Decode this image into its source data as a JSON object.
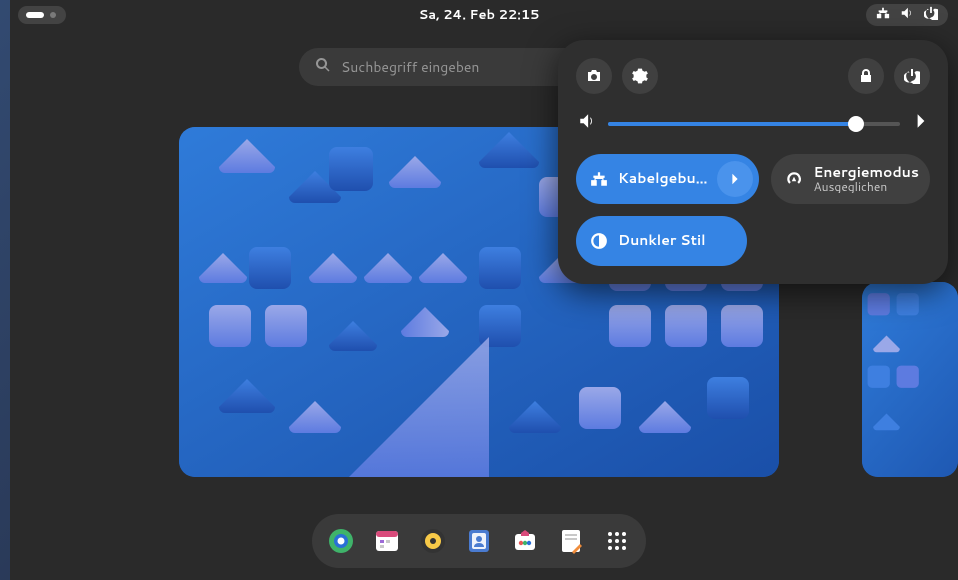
{
  "topbar": {
    "datetime": "Sa, 24. Feb  22:15"
  },
  "search": {
    "placeholder": "Suchbegriff eingeben"
  },
  "quick_settings": {
    "volume_percent": 85,
    "tiles": {
      "network": {
        "label": "Kabelgebu…",
        "active": true,
        "has_submenu": true
      },
      "power": {
        "label": "Energiemodus",
        "sublabel": "Ausgeglichen",
        "active": false,
        "has_submenu": false
      },
      "darkstyle": {
        "label": "Dunkler Stil",
        "active": true,
        "has_submenu": false
      }
    }
  },
  "dash": {
    "apps": [
      "web-browser",
      "calendar",
      "music",
      "contacts",
      "software",
      "text-editor",
      "app-grid"
    ]
  },
  "colors": {
    "accent": "#3584e4"
  }
}
